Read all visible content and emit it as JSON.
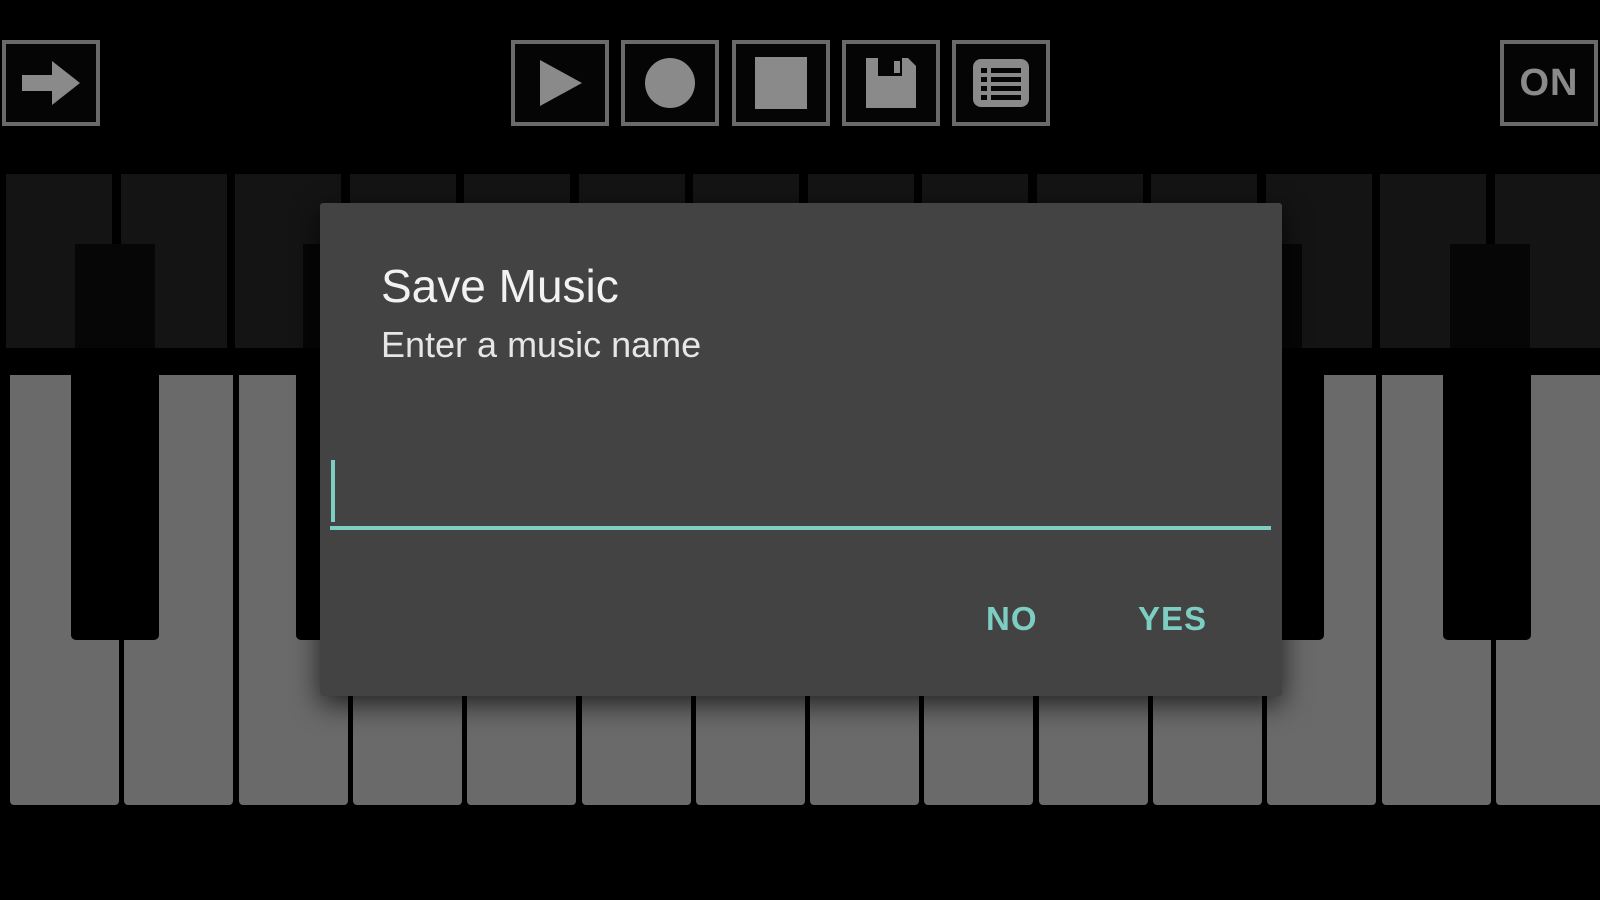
{
  "toolbar": {
    "buttons": [
      {
        "id": "exit",
        "icon": "arrow-right-icon"
      },
      {
        "id": "play",
        "icon": "play-icon"
      },
      {
        "id": "record",
        "icon": "record-icon"
      },
      {
        "id": "stop",
        "icon": "stop-icon"
      },
      {
        "id": "save",
        "icon": "floppy-disk-icon"
      },
      {
        "id": "list",
        "icon": "list-icon"
      }
    ],
    "toggle_label": "ON"
  },
  "dialog": {
    "title": "Save Music",
    "message": "Enter a music name",
    "input_value": "",
    "no_label": "NO",
    "yes_label": "YES"
  },
  "colors": {
    "accent": "#7ecdc3",
    "dialog_background": "#434343",
    "white_key": "#6a6a6a",
    "button_border": "#6a6a6a"
  }
}
